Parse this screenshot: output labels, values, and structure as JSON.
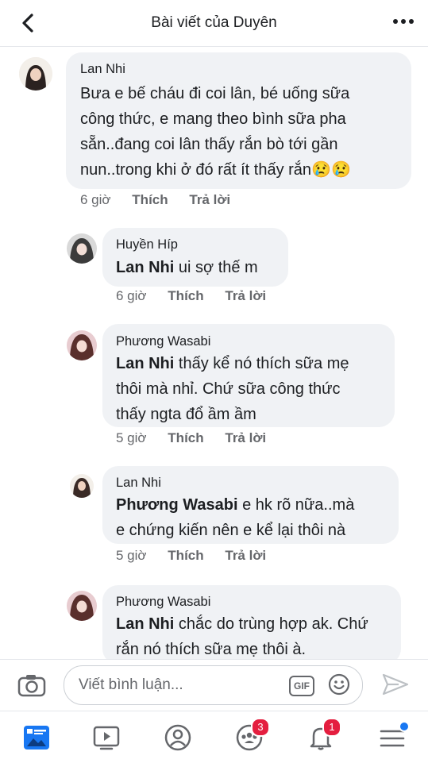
{
  "header": {
    "title": "Bài viết của Duyên"
  },
  "comments": [
    {
      "author": "Lan Nhi",
      "lines": [
        "Bưa e bế cháu đi coi lân, bé uống sữa",
        "công thức, e mang theo bình sữa pha",
        "sẵn..đang coi lân thấy rắn bò tới gần",
        "nun..trong khi ở đó rất ít thấy rắn😢😢"
      ],
      "time": "6 giờ",
      "like": "Thích",
      "reply": "Trả lời"
    },
    {
      "author": "Huyền Híp",
      "mention": "Lan Nhi",
      "lines": [
        " ui sợ thế m"
      ],
      "time": "6 giờ",
      "like": "Thích",
      "reply": "Trả lời"
    },
    {
      "author": "Phương Wasabi",
      "mention": "Lan Nhi",
      "lines": [
        " thấy kể nó thích sữa mẹ",
        "thôi mà nhỉ. Chứ sữa công thức",
        "thấy ngta đổ ầm ầm"
      ],
      "time": "5 giờ",
      "like": "Thích",
      "reply": "Trả lời"
    },
    {
      "author": "Lan Nhi",
      "mention": "Phương Wasabi",
      "lines": [
        "  e hk rõ nữa..mà",
        "e chứng kiến nên e kể lại thôi nà"
      ],
      "time": "5 giờ",
      "like": "Thích",
      "reply": "Trả lời"
    },
    {
      "author": "Phương Wasabi",
      "mention": "Lan Nhi",
      "lines": [
        " chắc do trùng hợp ak. Chứ",
        "rắn nó thích sữa mẹ thôi à."
      ]
    }
  ],
  "composer": {
    "placeholder": "Viết bình luận...",
    "gif_label": "GIF"
  },
  "tabs": [
    {
      "icon": "news-feed-icon"
    },
    {
      "icon": "watch-icon"
    },
    {
      "icon": "profile-icon"
    },
    {
      "icon": "groups-icon",
      "badge": "3"
    },
    {
      "icon": "notifications-icon",
      "badge": "1"
    },
    {
      "icon": "menu-icon"
    }
  ],
  "colors": {
    "bubble": "#f0f2f5",
    "meta": "#65676b",
    "badge": "#e41e3f",
    "accent": "#1877f2"
  }
}
